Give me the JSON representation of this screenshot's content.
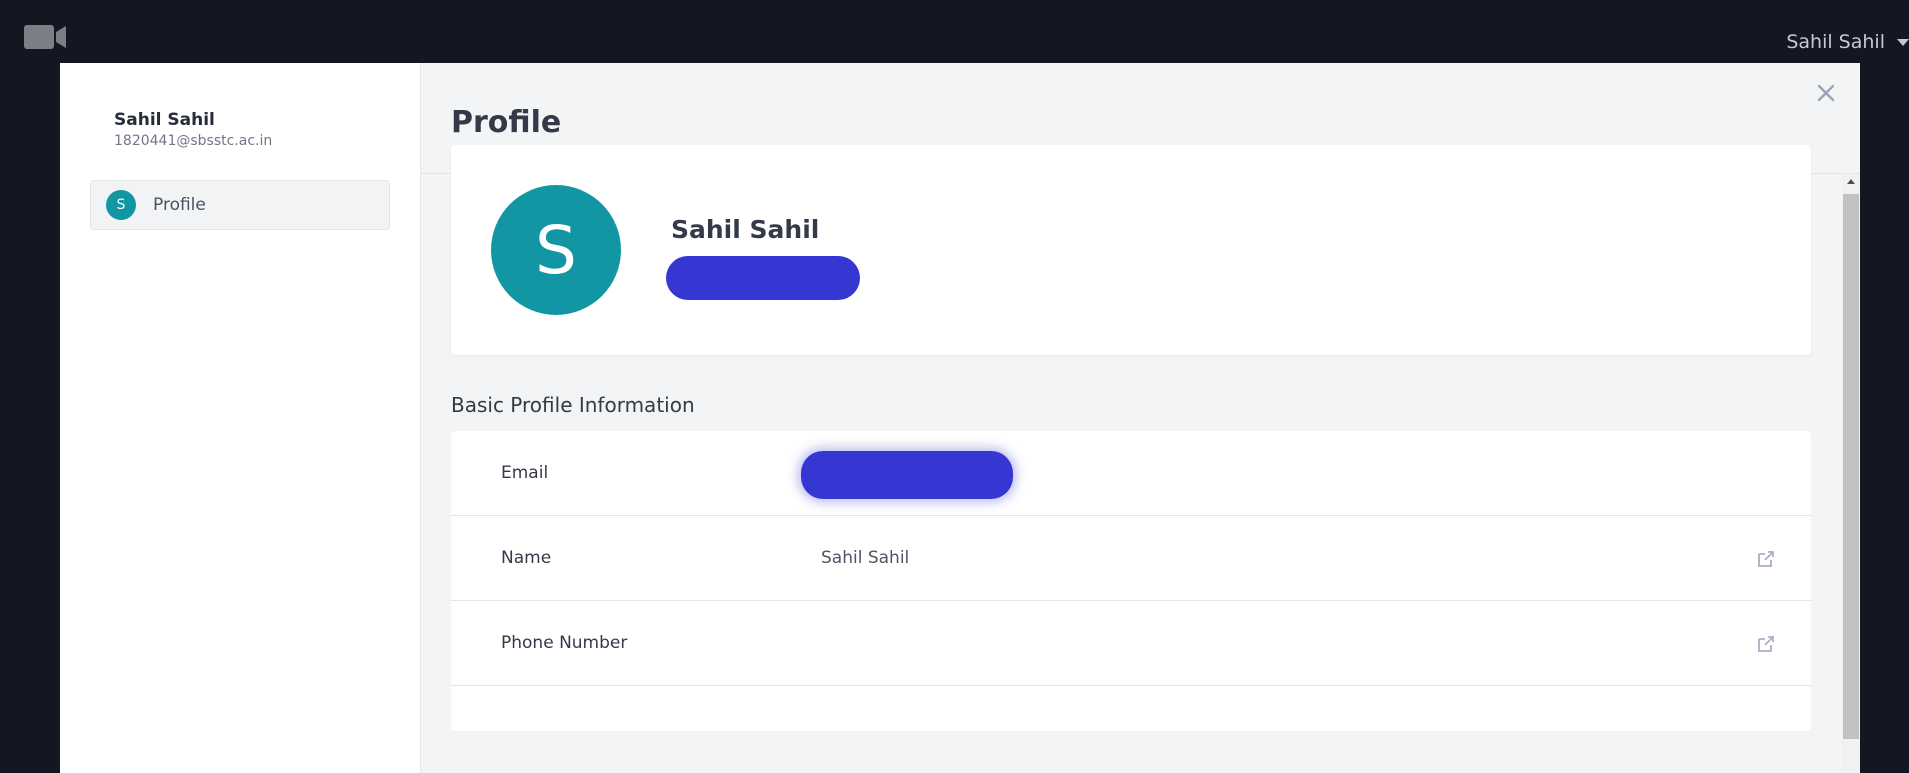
{
  "topbar": {
    "app_icon": "video-camera-icon",
    "user_name": "Sahil Sahil"
  },
  "sidebar": {
    "user_name": "Sahil Sahil",
    "user_email": "1820441@sbsstc.ac.in",
    "items": [
      {
        "avatar_letter": "S",
        "label": "Profile"
      }
    ]
  },
  "main": {
    "title": "Profile",
    "close_icon": "close-icon",
    "profile_card": {
      "avatar_letter": "S",
      "name": "Sahil Sahil"
    },
    "section_title": "Basic Profile Information",
    "rows": [
      {
        "key": "Email",
        "value": ""
      },
      {
        "key": "Name",
        "value": "Sahil Sahil",
        "edit_icon": "edit-icon"
      },
      {
        "key": "Phone Number",
        "value": "",
        "edit_icon": "edit-icon"
      }
    ]
  },
  "colors": {
    "background": "#131722",
    "accent": "#1396a3",
    "redaction": "#3637d3"
  }
}
